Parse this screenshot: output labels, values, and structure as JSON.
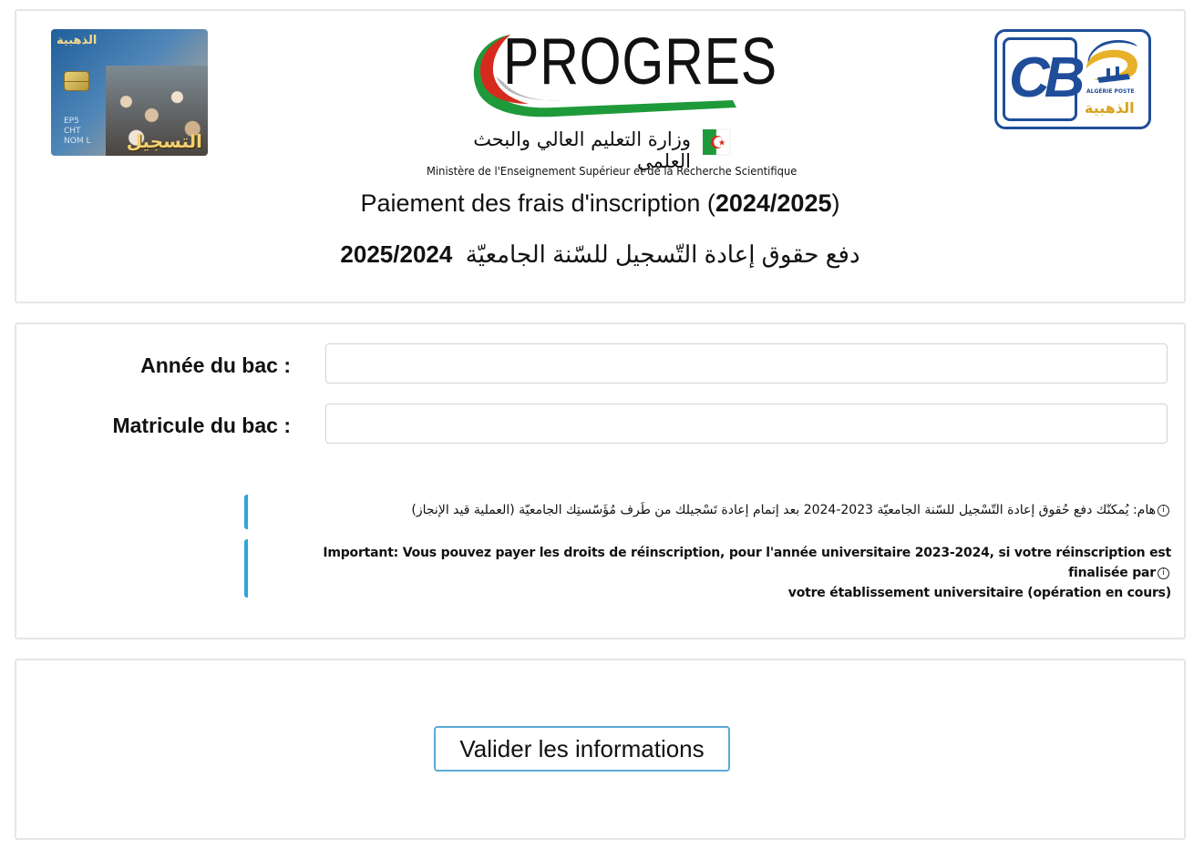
{
  "header": {
    "card_image": {
      "arabic_top": "الذهبية",
      "arabic_bottom": "التسجيل",
      "digits_line1": "EP5",
      "digits_line2": "CHT",
      "digits_line3": "NOM L"
    },
    "logo": {
      "word": "PROGRES",
      "ministry_ar": "وزارة التعليم العالي والبحث العلمي",
      "ministry_fr": "Ministère de l'Enseignement Supérieur et de la Recherche Scientifique",
      "colors": {
        "red": "#d52b1e",
        "green": "#1f9a3a"
      }
    },
    "ccp_logo": {
      "letters": "CB",
      "poste": "ALGÉRIE POSTE",
      "gold": "الذهبية",
      "colors": {
        "blue": "#1f4d9a",
        "gold": "#d7a21e"
      }
    },
    "title_fr": "Paiement des frais d'inscription (",
    "title_fr_year": "2024/2025",
    "title_fr_end": ")",
    "title_ar": "دفع حقوق إعادة التّسجيل للسّنة الجامعيّة",
    "title_ar_year": "2025/2024"
  },
  "form": {
    "bac_year_label": "Année du bac :",
    "bac_year_value": "",
    "bac_matricule_label": "Matricule du bac :",
    "bac_matricule_value": ""
  },
  "notices": {
    "arabic": "هام: يُمكنّك دفع حُقوق إعادة التّسْجيل للسّنة الجامعيّة 2023-2024 بعد إتمام إعادة تَسْجيلك من طَرف مُؤَسّستِك الجامعيّة (العملية قيد الإنجاز)",
    "french_line1": "Important: Vous pouvez payer les droits de réinscription, pour l'année universitaire 2023-2024, si votre réinscription est finalisée par",
    "french_line2": "votre établissement universitaire (opération en cours)",
    "accent_color": "#2aa6d9"
  },
  "actions": {
    "submit_label": "Valider les informations",
    "border_color": "#5ba9d6"
  }
}
